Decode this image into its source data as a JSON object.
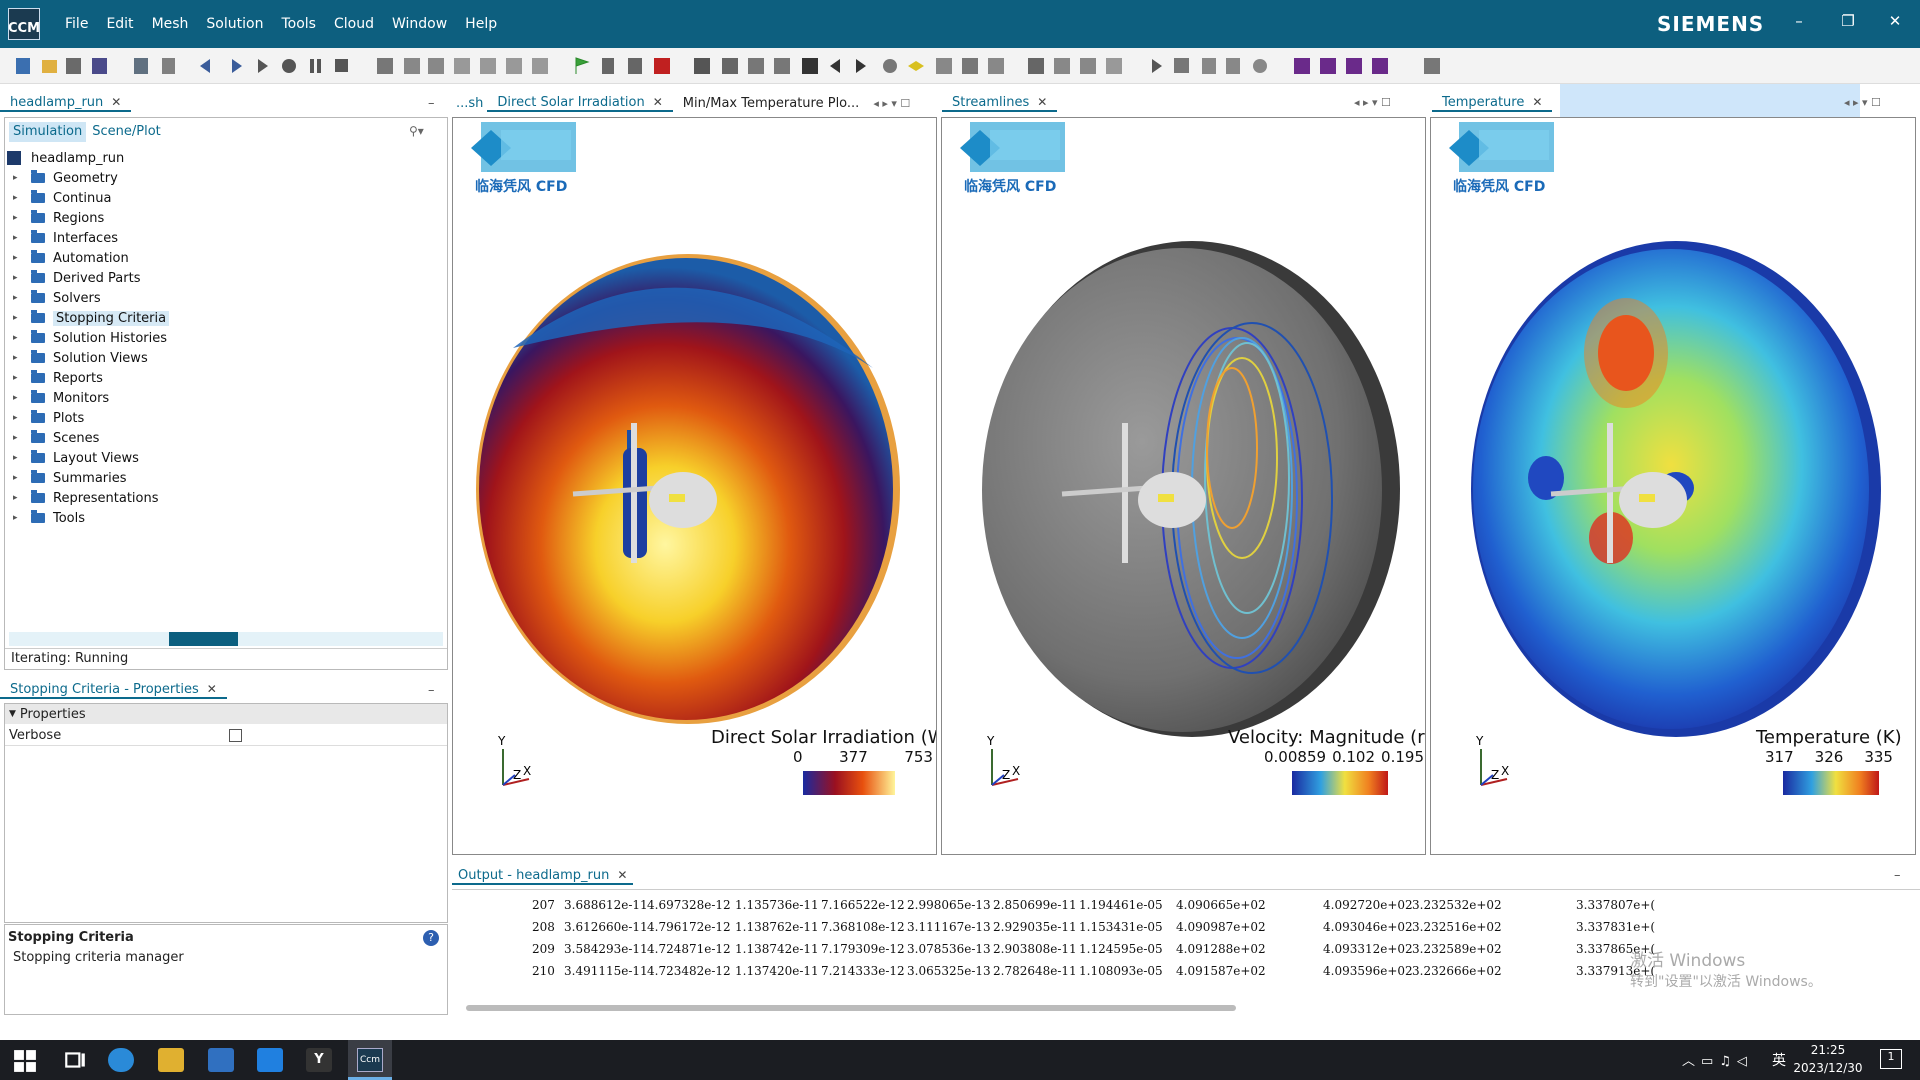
{
  "app": {
    "logo_text": "CCM",
    "menus": [
      "File",
      "Edit",
      "Mesh",
      "Solution",
      "Tools",
      "Cloud",
      "Window",
      "Help"
    ],
    "brand": "SIEMENS",
    "window_controls": {
      "minimize": "–",
      "restore": "❐",
      "close": "✕"
    }
  },
  "left_panel": {
    "tab": "headlamp_run",
    "subtabs": [
      "Simulation",
      "Scene/Plot"
    ],
    "tree_root": "headlamp_run",
    "tree": [
      "Geometry",
      "Continua",
      "Regions",
      "Interfaces",
      "Automation",
      "Derived Parts",
      "Solvers",
      "Stopping Criteria",
      "Solution Histories",
      "Solution Views",
      "Reports",
      "Monitors",
      "Plots",
      "Scenes",
      "Layout Views",
      "Summaries",
      "Representations",
      "Tools"
    ],
    "selected_item": "Stopping Criteria",
    "status": "Iterating: Running",
    "progress_fraction": 0.25
  },
  "properties_panel": {
    "tab": "Stopping Criteria - Properties",
    "section": "Properties",
    "rows": [
      {
        "name": "Verbose",
        "checked": false
      }
    ]
  },
  "description_panel": {
    "title": "Stopping Criteria",
    "text": "Stopping criteria manager"
  },
  "view_tabs": {
    "group1": [
      "...sh",
      "Direct Solar Irradiation",
      "Min/Max Temperature Plo..."
    ],
    "group1_active": "Direct Solar Irradiation",
    "group2": [
      "Streamlines"
    ],
    "group3": [
      "Temperature"
    ]
  },
  "watermark_text": "临海凭风 CFD",
  "viewports": [
    {
      "legend_title": "Direct Solar Irradiation (W",
      "ticks": [
        "0",
        "377",
        "753"
      ],
      "axes": {
        "y": "Y",
        "z": "Z",
        "x": "X"
      }
    },
    {
      "legend_title": "Velocity: Magnitude (r",
      "ticks": [
        "0.00859",
        "0.102",
        "0.195"
      ],
      "axes": {
        "y": "Y",
        "z": "Z",
        "x": "X"
      }
    },
    {
      "legend_title": "Temperature (K)",
      "ticks": [
        "317",
        "326",
        "335"
      ],
      "axes": {
        "y": "Y",
        "z": "Z",
        "x": "X"
      }
    }
  ],
  "output": {
    "tab": "Output - headlamp_run",
    "rows": [
      [
        "207",
        "3.688612e-11",
        "4.697328e-12",
        "1.135736e-11",
        "7.166522e-12",
        "2.998065e-13",
        "2.850699e-11",
        "1.194461e-05",
        "4.090665e+02",
        "4.092720e+02",
        "3.232532e+02",
        "3.337807e+("
      ],
      [
        "208",
        "3.612660e-11",
        "4.796172e-12",
        "1.138762e-11",
        "7.368108e-12",
        "3.111167e-13",
        "2.929035e-11",
        "1.153431e-05",
        "4.090987e+02",
        "4.093046e+02",
        "3.232516e+02",
        "3.337831e+("
      ],
      [
        "209",
        "3.584293e-11",
        "4.724871e-12",
        "1.138742e-11",
        "7.179309e-12",
        "3.078536e-13",
        "2.903808e-11",
        "1.124595e-05",
        "4.091288e+02",
        "4.093312e+02",
        "3.232589e+02",
        "3.337865e+("
      ],
      [
        "210",
        "3.491115e-11",
        "4.723482e-12",
        "1.137420e-11",
        "7.214333e-12",
        "3.065325e-13",
        "2.782648e-11",
        "1.108093e-05",
        "4.091587e+02",
        "4.093596e+02",
        "3.232666e+02",
        "3.337913e+("
      ]
    ],
    "activation": [
      "激活 Windows",
      "转到\"设置\"以激活 Windows。"
    ]
  },
  "taskbar": {
    "time": "21:25",
    "date": "2023/12/30",
    "ime": "英",
    "notification_count": "1"
  }
}
